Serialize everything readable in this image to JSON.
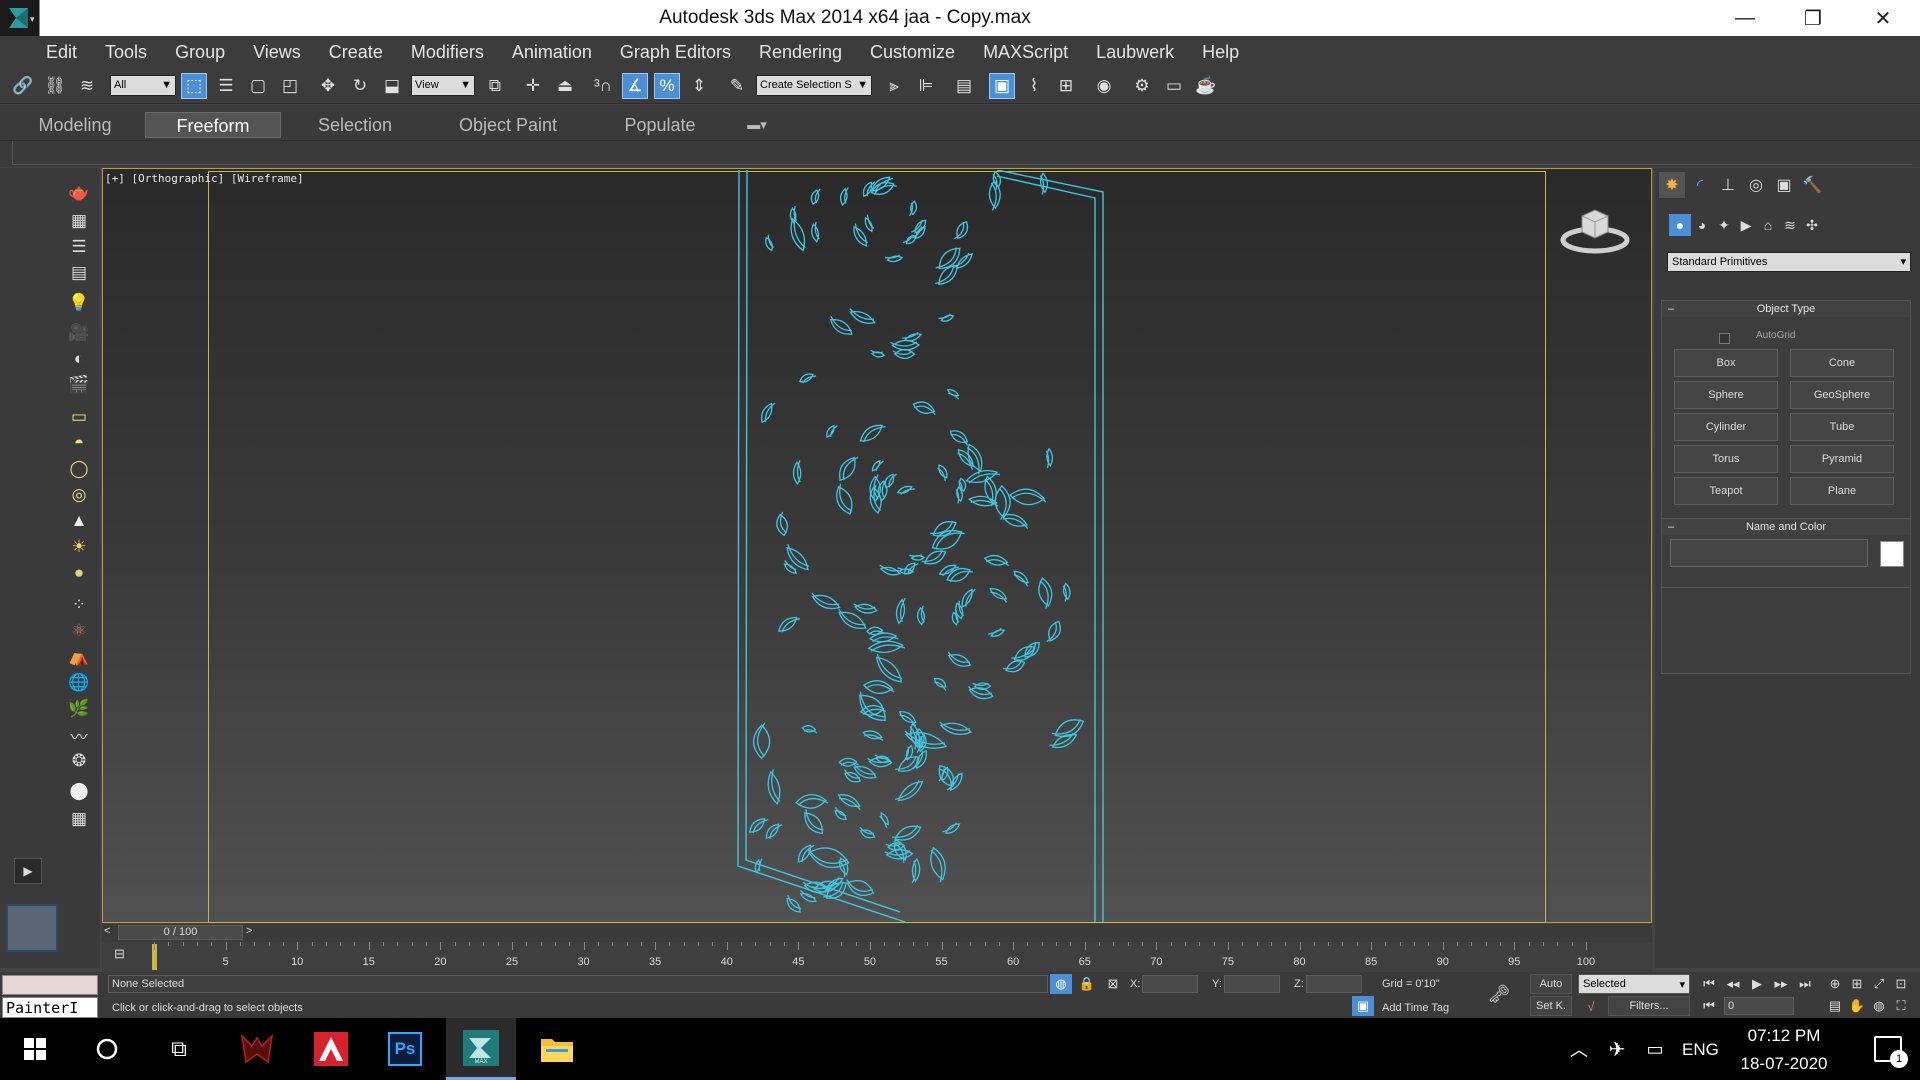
{
  "window": {
    "title": "Autodesk 3ds Max  2014 x64       jaa - Copy.max",
    "minimize": "—",
    "restore": "❐",
    "close": "✕"
  },
  "menu": [
    "Edit",
    "Tools",
    "Group",
    "Views",
    "Create",
    "Modifiers",
    "Animation",
    "Graph Editors",
    "Rendering",
    "Customize",
    "MAXScript",
    "Laubwerk",
    "Help"
  ],
  "toolbar": {
    "selection_filter": "All",
    "ref_coord": "View",
    "named_selection": "Create Selection S"
  },
  "ribbon": {
    "tabs": [
      "Modeling",
      "Freeform",
      "Selection",
      "Object Paint",
      "Populate"
    ],
    "active_tab": "Freeform"
  },
  "viewport": {
    "label": "[+] [Orthographic] [Wireframe]",
    "wire_color": "#3cc7e2"
  },
  "command_panel": {
    "category": "Standard Primitives",
    "object_type_title": "Object Type",
    "autogrid": "AutoGrid",
    "buttons": [
      "Box",
      "Cone",
      "Sphere",
      "GeoSphere",
      "Cylinder",
      "Tube",
      "Torus",
      "Pyramid",
      "Teapot",
      "Plane"
    ],
    "name_color_title": "Name and Color",
    "rollout_collapse": "–"
  },
  "timeline": {
    "frame_display": "0 / 100",
    "prev": "<",
    "next": ">",
    "ticks": [
      "5",
      "10",
      "15",
      "20",
      "25",
      "30",
      "35",
      "40",
      "45",
      "50",
      "55",
      "60",
      "65",
      "70",
      "75",
      "80",
      "85",
      "90",
      "95",
      "100"
    ]
  },
  "status": {
    "selection": "None Selected",
    "prompt": "Click or click-and-drag to select objects",
    "x_label": "X:",
    "y_label": "Y:",
    "z_label": "Z:",
    "grid": "Grid = 0'10\"",
    "add_time_tag": "Add Time Tag",
    "auto": "Auto",
    "set_key": "Set K.",
    "key_filter_select": "Selected",
    "filters": "Filters...",
    "frame_field": "0",
    "maxscript_listener": "PainterI"
  },
  "taskbar": {
    "time": "07:12 PM",
    "date": "18-07-2020",
    "language": "ENG",
    "notifications": "1",
    "ps_label": "Ps",
    "max_label": "MAX"
  }
}
